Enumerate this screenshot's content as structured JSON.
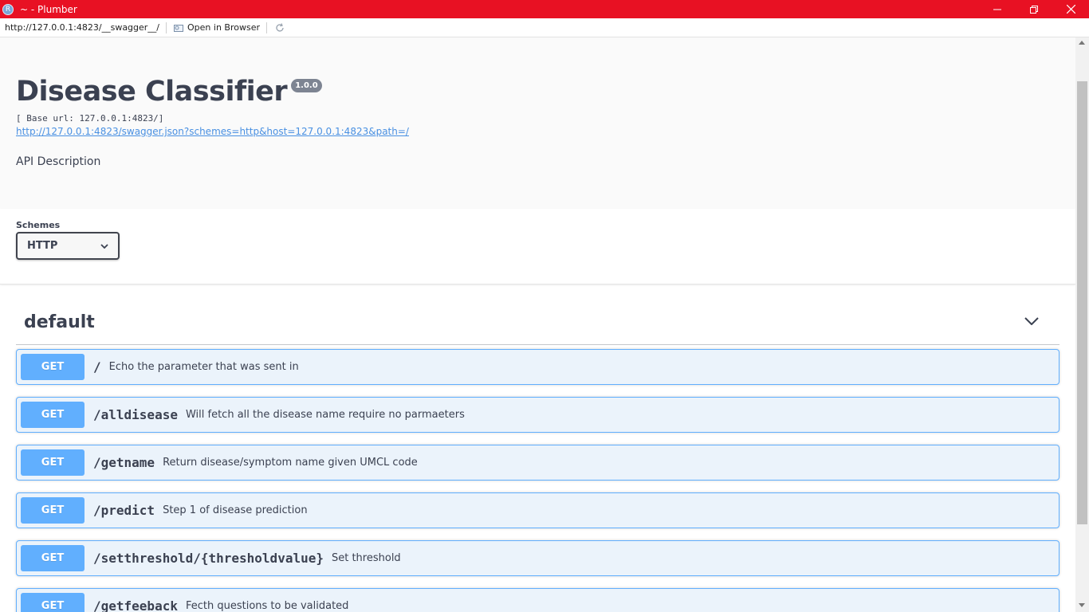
{
  "window": {
    "title": "~ - Plumber",
    "app_icon_letter": "R",
    "titlebar_color": "#e81123"
  },
  "address_bar": {
    "url": "http://127.0.0.1:4823/__swagger__/",
    "open_in_browser": "Open in Browser"
  },
  "api": {
    "title": "Disease Classifier",
    "version": "1.0.0",
    "base_url": "[ Base url: 127.0.0.1:4823/]",
    "spec_link": "http://127.0.0.1:4823/swagger.json?schemes=http&host=127.0.0.1:4823&path=/",
    "description": "API Description"
  },
  "schemes": {
    "label": "Schemes",
    "selected": "HTTP"
  },
  "tag": {
    "name": "default"
  },
  "operations": [
    {
      "method": "GET",
      "path": "/",
      "summary": "Echo the parameter that was sent in"
    },
    {
      "method": "GET",
      "path": "/alldisease",
      "summary": "Will fetch all the disease name require no parmaeters"
    },
    {
      "method": "GET",
      "path": "/getname",
      "summary": "Return disease/symptom name given UMCL code"
    },
    {
      "method": "GET",
      "path": "/predict",
      "summary": "Step 1 of disease prediction"
    },
    {
      "method": "GET",
      "path": "/setthreshold/{thresholdvalue}",
      "summary": "Set threshold"
    },
    {
      "method": "GET",
      "path": "/getfeeback",
      "summary": "Fecth questions to be validated"
    }
  ],
  "colors": {
    "get_method": "#61affe",
    "get_background": "#ebf3fb",
    "text": "#3b4151",
    "link": "#4990e2"
  }
}
